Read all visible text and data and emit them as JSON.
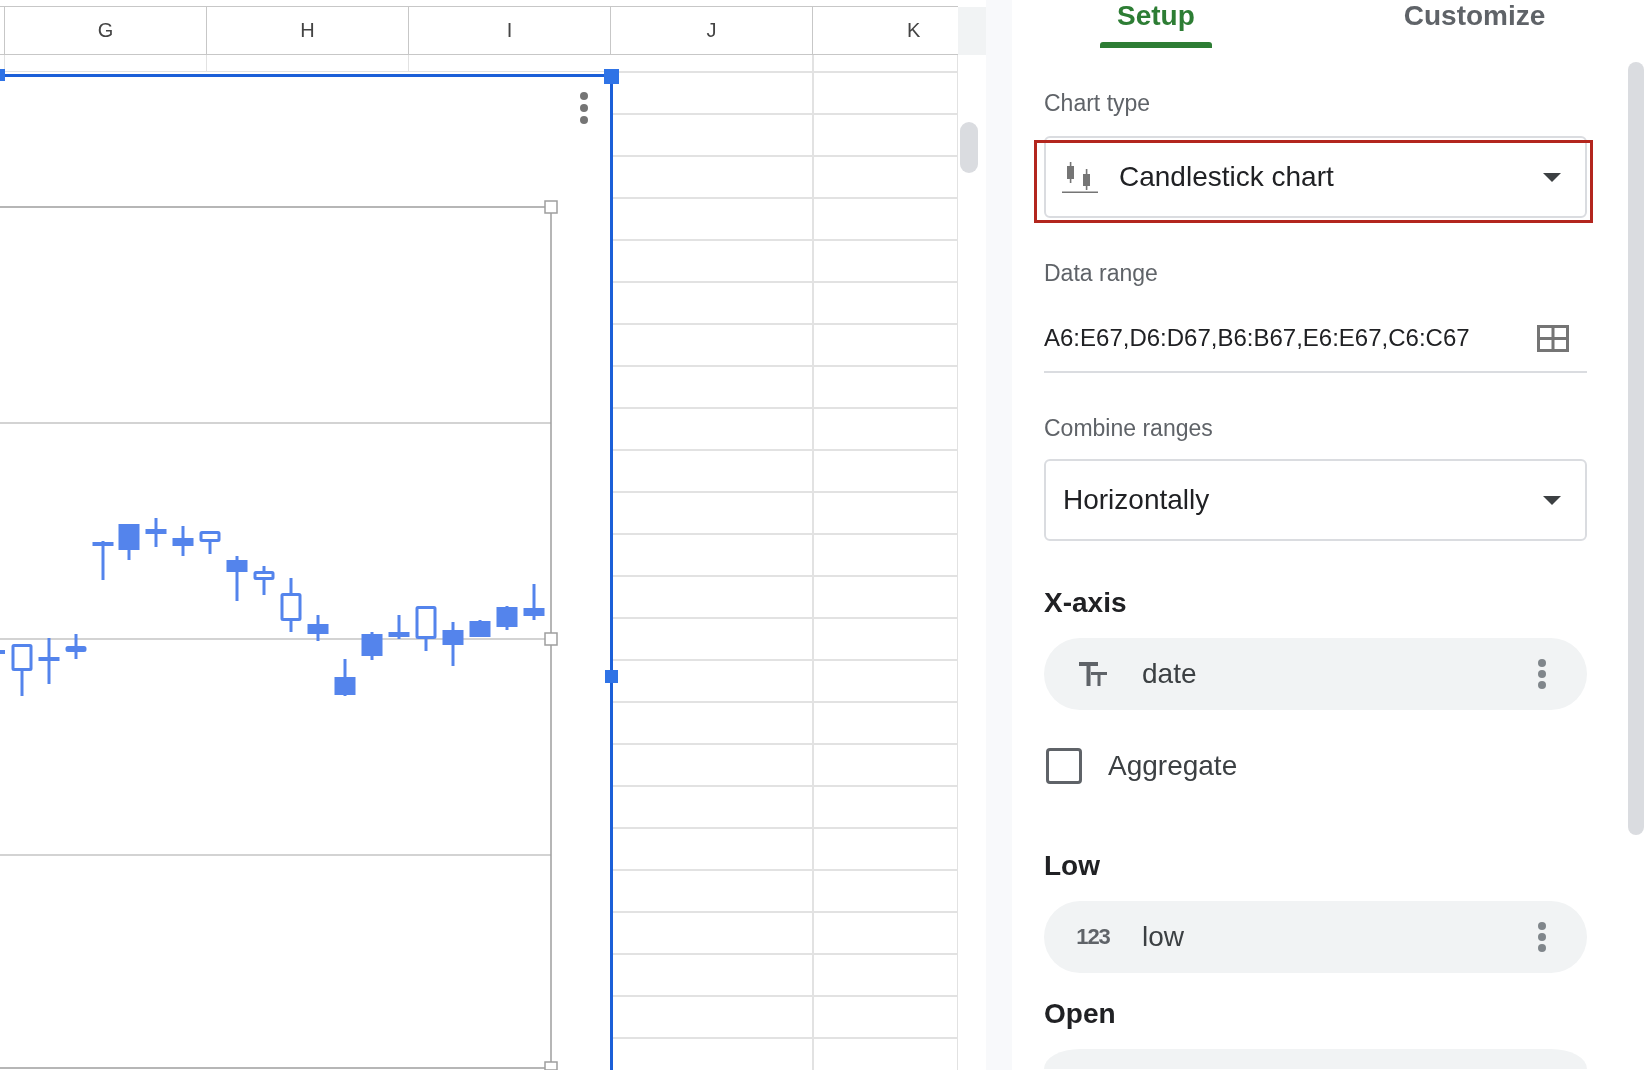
{
  "spreadsheet": {
    "column_headers": [
      "G",
      "H",
      "I",
      "J",
      "K"
    ]
  },
  "chart": {
    "selected": true
  },
  "editor": {
    "tabs": [
      {
        "label": "Setup",
        "selected": true
      },
      {
        "label": "Customize",
        "selected": false
      }
    ],
    "chart_type": {
      "label": "Chart type",
      "value": "Candlestick chart",
      "highlighted": true
    },
    "data_range": {
      "label": "Data range",
      "value": "A6:E67,D6:D67,B6:B67,E6:E67,C6:C67"
    },
    "combine_ranges": {
      "label": "Combine ranges",
      "value": "Horizontally"
    },
    "sections": [
      {
        "title": "X-axis",
        "fields": [
          {
            "kind": "text",
            "name": "date"
          }
        ],
        "aggregate": {
          "label": "Aggregate",
          "checked": false
        }
      },
      {
        "title": "Low",
        "fields": [
          {
            "kind": "number",
            "type_icon": "123",
            "name": "low"
          }
        ]
      },
      {
        "title": "Open",
        "fields": [
          {
            "kind": "cut_off"
          }
        ]
      }
    ]
  }
}
